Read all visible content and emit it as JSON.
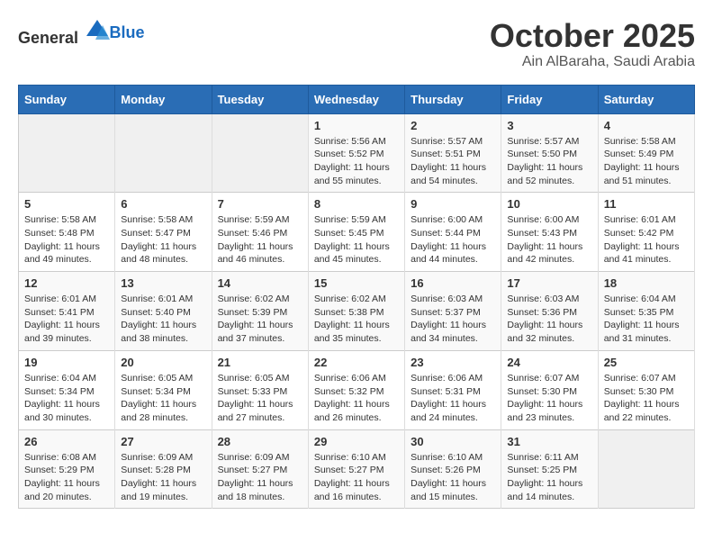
{
  "header": {
    "logo_general": "General",
    "logo_blue": "Blue",
    "month": "October 2025",
    "location": "Ain AlBaraha, Saudi Arabia"
  },
  "weekdays": [
    "Sunday",
    "Monday",
    "Tuesday",
    "Wednesday",
    "Thursday",
    "Friday",
    "Saturday"
  ],
  "weeks": [
    [
      {
        "day": "",
        "empty": true
      },
      {
        "day": "",
        "empty": true
      },
      {
        "day": "",
        "empty": true
      },
      {
        "day": "1",
        "sunrise": "Sunrise: 5:56 AM",
        "sunset": "Sunset: 5:52 PM",
        "daylight": "Daylight: 11 hours and 55 minutes."
      },
      {
        "day": "2",
        "sunrise": "Sunrise: 5:57 AM",
        "sunset": "Sunset: 5:51 PM",
        "daylight": "Daylight: 11 hours and 54 minutes."
      },
      {
        "day": "3",
        "sunrise": "Sunrise: 5:57 AM",
        "sunset": "Sunset: 5:50 PM",
        "daylight": "Daylight: 11 hours and 52 minutes."
      },
      {
        "day": "4",
        "sunrise": "Sunrise: 5:58 AM",
        "sunset": "Sunset: 5:49 PM",
        "daylight": "Daylight: 11 hours and 51 minutes."
      }
    ],
    [
      {
        "day": "5",
        "sunrise": "Sunrise: 5:58 AM",
        "sunset": "Sunset: 5:48 PM",
        "daylight": "Daylight: 11 hours and 49 minutes."
      },
      {
        "day": "6",
        "sunrise": "Sunrise: 5:58 AM",
        "sunset": "Sunset: 5:47 PM",
        "daylight": "Daylight: 11 hours and 48 minutes."
      },
      {
        "day": "7",
        "sunrise": "Sunrise: 5:59 AM",
        "sunset": "Sunset: 5:46 PM",
        "daylight": "Daylight: 11 hours and 46 minutes."
      },
      {
        "day": "8",
        "sunrise": "Sunrise: 5:59 AM",
        "sunset": "Sunset: 5:45 PM",
        "daylight": "Daylight: 11 hours and 45 minutes."
      },
      {
        "day": "9",
        "sunrise": "Sunrise: 6:00 AM",
        "sunset": "Sunset: 5:44 PM",
        "daylight": "Daylight: 11 hours and 44 minutes."
      },
      {
        "day": "10",
        "sunrise": "Sunrise: 6:00 AM",
        "sunset": "Sunset: 5:43 PM",
        "daylight": "Daylight: 11 hours and 42 minutes."
      },
      {
        "day": "11",
        "sunrise": "Sunrise: 6:01 AM",
        "sunset": "Sunset: 5:42 PM",
        "daylight": "Daylight: 11 hours and 41 minutes."
      }
    ],
    [
      {
        "day": "12",
        "sunrise": "Sunrise: 6:01 AM",
        "sunset": "Sunset: 5:41 PM",
        "daylight": "Daylight: 11 hours and 39 minutes."
      },
      {
        "day": "13",
        "sunrise": "Sunrise: 6:01 AM",
        "sunset": "Sunset: 5:40 PM",
        "daylight": "Daylight: 11 hours and 38 minutes."
      },
      {
        "day": "14",
        "sunrise": "Sunrise: 6:02 AM",
        "sunset": "Sunset: 5:39 PM",
        "daylight": "Daylight: 11 hours and 37 minutes."
      },
      {
        "day": "15",
        "sunrise": "Sunrise: 6:02 AM",
        "sunset": "Sunset: 5:38 PM",
        "daylight": "Daylight: 11 hours and 35 minutes."
      },
      {
        "day": "16",
        "sunrise": "Sunrise: 6:03 AM",
        "sunset": "Sunset: 5:37 PM",
        "daylight": "Daylight: 11 hours and 34 minutes."
      },
      {
        "day": "17",
        "sunrise": "Sunrise: 6:03 AM",
        "sunset": "Sunset: 5:36 PM",
        "daylight": "Daylight: 11 hours and 32 minutes."
      },
      {
        "day": "18",
        "sunrise": "Sunrise: 6:04 AM",
        "sunset": "Sunset: 5:35 PM",
        "daylight": "Daylight: 11 hours and 31 minutes."
      }
    ],
    [
      {
        "day": "19",
        "sunrise": "Sunrise: 6:04 AM",
        "sunset": "Sunset: 5:34 PM",
        "daylight": "Daylight: 11 hours and 30 minutes."
      },
      {
        "day": "20",
        "sunrise": "Sunrise: 6:05 AM",
        "sunset": "Sunset: 5:34 PM",
        "daylight": "Daylight: 11 hours and 28 minutes."
      },
      {
        "day": "21",
        "sunrise": "Sunrise: 6:05 AM",
        "sunset": "Sunset: 5:33 PM",
        "daylight": "Daylight: 11 hours and 27 minutes."
      },
      {
        "day": "22",
        "sunrise": "Sunrise: 6:06 AM",
        "sunset": "Sunset: 5:32 PM",
        "daylight": "Daylight: 11 hours and 26 minutes."
      },
      {
        "day": "23",
        "sunrise": "Sunrise: 6:06 AM",
        "sunset": "Sunset: 5:31 PM",
        "daylight": "Daylight: 11 hours and 24 minutes."
      },
      {
        "day": "24",
        "sunrise": "Sunrise: 6:07 AM",
        "sunset": "Sunset: 5:30 PM",
        "daylight": "Daylight: 11 hours and 23 minutes."
      },
      {
        "day": "25",
        "sunrise": "Sunrise: 6:07 AM",
        "sunset": "Sunset: 5:30 PM",
        "daylight": "Daylight: 11 hours and 22 minutes."
      }
    ],
    [
      {
        "day": "26",
        "sunrise": "Sunrise: 6:08 AM",
        "sunset": "Sunset: 5:29 PM",
        "daylight": "Daylight: 11 hours and 20 minutes."
      },
      {
        "day": "27",
        "sunrise": "Sunrise: 6:09 AM",
        "sunset": "Sunset: 5:28 PM",
        "daylight": "Daylight: 11 hours and 19 minutes."
      },
      {
        "day": "28",
        "sunrise": "Sunrise: 6:09 AM",
        "sunset": "Sunset: 5:27 PM",
        "daylight": "Daylight: 11 hours and 18 minutes."
      },
      {
        "day": "29",
        "sunrise": "Sunrise: 6:10 AM",
        "sunset": "Sunset: 5:27 PM",
        "daylight": "Daylight: 11 hours and 16 minutes."
      },
      {
        "day": "30",
        "sunrise": "Sunrise: 6:10 AM",
        "sunset": "Sunset: 5:26 PM",
        "daylight": "Daylight: 11 hours and 15 minutes."
      },
      {
        "day": "31",
        "sunrise": "Sunrise: 6:11 AM",
        "sunset": "Sunset: 5:25 PM",
        "daylight": "Daylight: 11 hours and 14 minutes."
      },
      {
        "day": "",
        "empty": true
      }
    ]
  ]
}
